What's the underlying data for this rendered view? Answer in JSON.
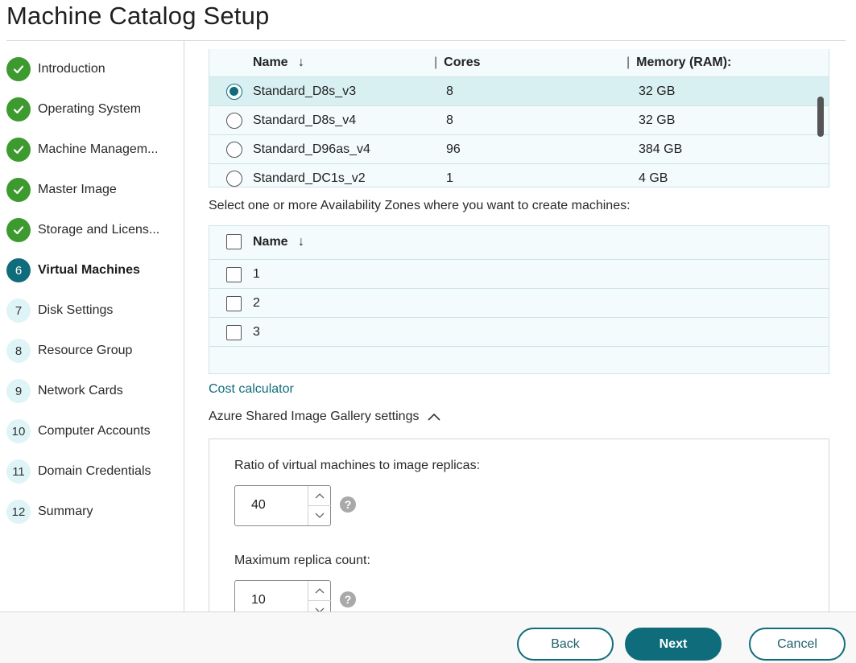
{
  "window": {
    "title": "Machine Catalog Setup"
  },
  "sidebar": {
    "steps": [
      {
        "num": "",
        "label": "Introduction",
        "state": "done"
      },
      {
        "num": "",
        "label": "Operating System",
        "state": "done"
      },
      {
        "num": "",
        "label": "Machine Managem...",
        "state": "done"
      },
      {
        "num": "",
        "label": "Master Image",
        "state": "done"
      },
      {
        "num": "",
        "label": "Storage and Licens...",
        "state": "done"
      },
      {
        "num": "6",
        "label": "Virtual Machines",
        "state": "current"
      },
      {
        "num": "7",
        "label": "Disk Settings",
        "state": "todo"
      },
      {
        "num": "8",
        "label": "Resource Group",
        "state": "todo"
      },
      {
        "num": "9",
        "label": "Network Cards",
        "state": "todo"
      },
      {
        "num": "10",
        "label": "Computer Accounts",
        "state": "todo"
      },
      {
        "num": "11",
        "label": "Domain Credentials",
        "state": "todo"
      },
      {
        "num": "12",
        "label": "Summary",
        "state": "todo"
      }
    ]
  },
  "vm_table": {
    "columns": {
      "name": "Name",
      "sort_glyph": "↓",
      "cores": "Cores",
      "memory": "Memory (RAM):",
      "separator": "|"
    },
    "rows": [
      {
        "name": "Standard_D8s_v3",
        "cores": "8",
        "memory": "32 GB",
        "selected": true
      },
      {
        "name": "Standard_D8s_v4",
        "cores": "8",
        "memory": "32 GB",
        "selected": false
      },
      {
        "name": "Standard_D96as_v4",
        "cores": "96",
        "memory": "384 GB",
        "selected": false
      },
      {
        "name": "Standard_DC1s_v2",
        "cores": "1",
        "memory": "4 GB",
        "selected": false
      }
    ]
  },
  "availability_zones": {
    "prompt": "Select one or more Availability Zones where you want to create machines:",
    "header": "Name",
    "sort_glyph": "↓",
    "zones": [
      "1",
      "2",
      "3"
    ]
  },
  "cost_calculator": {
    "label": "Cost calculator"
  },
  "gallery": {
    "toggle_label": "Azure Shared Image Gallery settings",
    "ratio_label": "Ratio of virtual machines to image replicas:",
    "ratio_value": "40",
    "max_label": "Maximum replica count:",
    "max_value": "10",
    "help_glyph": "?"
  },
  "footer": {
    "back": "Back",
    "next": "Next",
    "cancel": "Cancel"
  },
  "colors": {
    "accent": "#0f6d7b",
    "done": "#3c9a2e",
    "todo_badge": "#dff4f6",
    "table_bg": "#f3fbfc"
  },
  "icons": {
    "done": "checkmark-icon",
    "sort": "sort-arrow-icon",
    "collapse": "chevron-up-icon",
    "help": "help-icon"
  }
}
